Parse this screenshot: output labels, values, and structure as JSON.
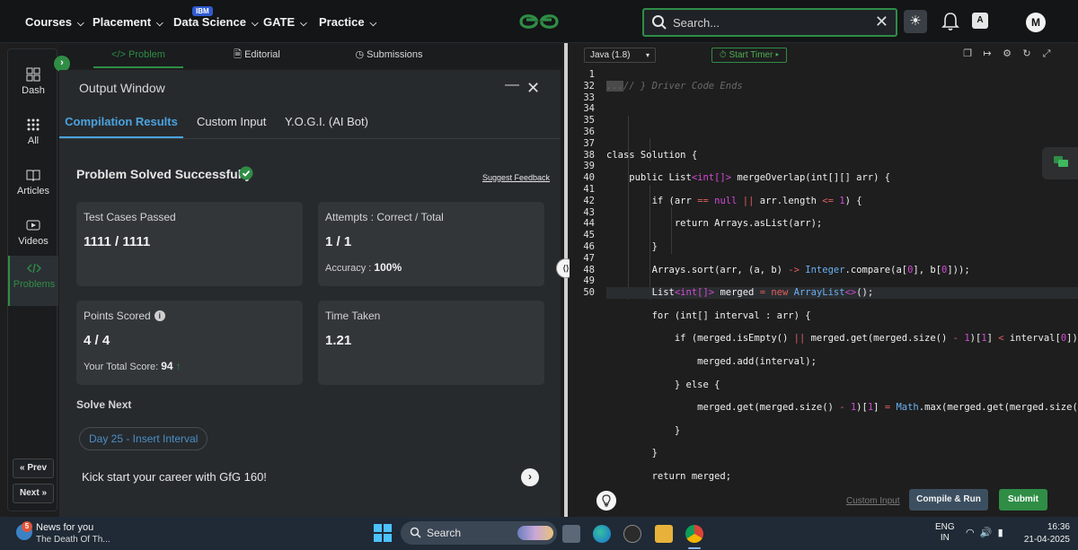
{
  "topnav": {
    "items": [
      {
        "label": "Courses"
      },
      {
        "label": "Placement"
      },
      {
        "label": "Data Science"
      },
      {
        "label": "GATE"
      },
      {
        "label": "Practice"
      }
    ],
    "ibm_badge": "IBM",
    "search_placeholder": "Search...",
    "avatar_initial": "M",
    "translate_glyph": "A",
    "brand_color": "#2f8d46"
  },
  "sidebar": {
    "items": [
      {
        "label": "Dash",
        "icon": "dashboard-icon"
      },
      {
        "label": "All",
        "icon": "grid-icon"
      },
      {
        "label": "Articles",
        "icon": "book-icon"
      },
      {
        "label": "Videos",
        "icon": "play-icon"
      },
      {
        "label": "Problems",
        "icon": "code-icon",
        "active": true
      }
    ],
    "prev_label": "« Prev",
    "next_label": "Next »"
  },
  "left_tabs": [
    {
      "label": "</> Problem",
      "active": true
    },
    {
      "label": "Editorial"
    },
    {
      "label": "Submissions"
    }
  ],
  "output_window": {
    "title": "Output Window",
    "tabs": [
      {
        "label": "Compilation Results",
        "active": true
      },
      {
        "label": "Custom Input"
      },
      {
        "label": "Y.O.G.I. (AI Bot)"
      }
    ],
    "status": "Problem Solved Successfully",
    "suggest_feedback": "Suggest Feedback",
    "cards": {
      "test_cases": {
        "label": "Test Cases Passed",
        "value": "1111 / 1111"
      },
      "attempts": {
        "label": "Attempts : Correct / Total",
        "value": "1 / 1",
        "sub_label": "Accuracy :",
        "sub_value": "100%"
      },
      "points": {
        "label": "Points Scored",
        "value": "4 / 4",
        "sub_label": "Your Total Score:",
        "sub_value": "94"
      },
      "time": {
        "label": "Time Taken",
        "value": "1.21"
      }
    },
    "solve_next_label": "Solve Next",
    "next_problem": "Day 25 - Insert Interval",
    "promo": "Kick start your career with GfG 160!"
  },
  "editor": {
    "language": "Java (1.8)",
    "start_timer": "Start Timer",
    "line_numbers": [
      "1",
      "32",
      "33",
      "34",
      "35",
      "36",
      "37",
      "38",
      "39",
      "40",
      "41",
      "42",
      "43",
      "44",
      "45",
      "46",
      "47",
      "48",
      "49",
      "50"
    ],
    "custom_input_label": "Custom Input",
    "compile_run_label": "Compile & Run",
    "submit_label": "Submit"
  },
  "taskbar": {
    "news_title": "News for you",
    "news_subtitle": "The Death Of Th...",
    "news_badge": "5",
    "search_label": "Search",
    "lang_line1": "ENG",
    "lang_line2": "IN",
    "time": "16:36",
    "date": "21-04-2025"
  }
}
